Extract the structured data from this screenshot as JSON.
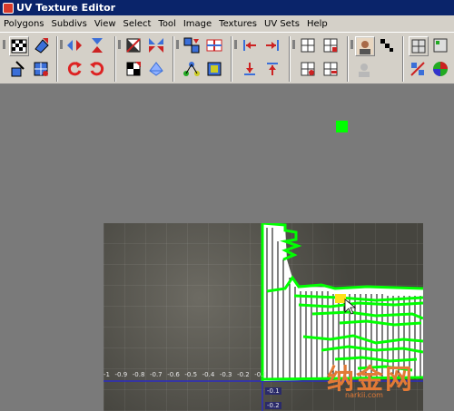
{
  "window": {
    "title": "UV Texture Editor"
  },
  "menu": {
    "items": [
      "Polygons",
      "Subdivs",
      "View",
      "Select",
      "Tool",
      "Image",
      "Textures",
      "UV Sets",
      "Help"
    ]
  },
  "toolbar": {
    "icons": [
      "uv-checker-icon",
      "uv-move-icon",
      "flip-u-icon",
      "flip-v-icon",
      "cut-uv-icon",
      "sew-uv-icon",
      "align-left-icon",
      "align-right-icon",
      "split-h-icon",
      "grid-uv-icon",
      "rotate-ccw-icon",
      "rotate-cw-icon",
      "uv-unfold-icon",
      "uv-layout-icon",
      "uv-relax-icon",
      "uv-normalize-icon",
      "uv-paint-icon",
      "move-left-icon",
      "move-right-icon",
      "move-down-icon",
      "move-up-icon",
      "view-grid-a-icon",
      "view-grid-b-icon",
      "view-grid-c-icon",
      "view-grid-d-icon",
      "shaded-uv-icon",
      "dim-image-icon",
      "display-grid-icon",
      "pixel-snap-icon",
      "color-ball-icon"
    ]
  },
  "viewport": {
    "u_axis_labels": [
      "-1",
      "-0.9",
      "-0.8",
      "-0.7",
      "-0.6",
      "-0.5",
      "-0.4",
      "-0.3",
      "-0.2",
      "-0.1"
    ],
    "v_axis_labels": [
      "-0.1",
      "-0.2"
    ],
    "accent_color": "#00ff00",
    "texture_dim_color": "#4b4b46"
  },
  "watermark": {
    "text": "纳金网",
    "sub": "narkii.com",
    "color": "#e27a36"
  }
}
